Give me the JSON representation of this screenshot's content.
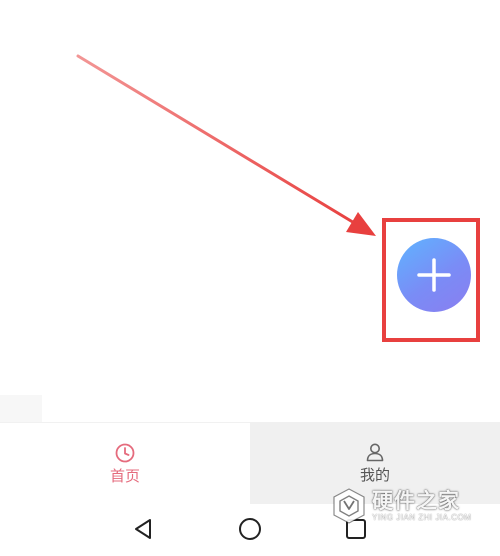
{
  "colors": {
    "annotation_red": "#e8403f",
    "fab_gradient_start": "#5fb4ff",
    "fab_gradient_end": "#8a7ef0",
    "active_tab": "#e56b7d",
    "inactive_tab": "#555555"
  },
  "fab": {
    "icon": "plus-icon"
  },
  "bottom_nav": {
    "tabs": [
      {
        "label": "首页",
        "icon": "clock-icon",
        "active": true
      },
      {
        "label": "我的",
        "icon": "user-icon",
        "active": false
      }
    ]
  },
  "system_nav": {
    "buttons": [
      "back-triangle-icon",
      "home-circle-icon",
      "recent-square-icon"
    ]
  },
  "watermark": {
    "title": "硬件之家",
    "subtitle": "YING JIAN ZHI JIA.COM"
  }
}
